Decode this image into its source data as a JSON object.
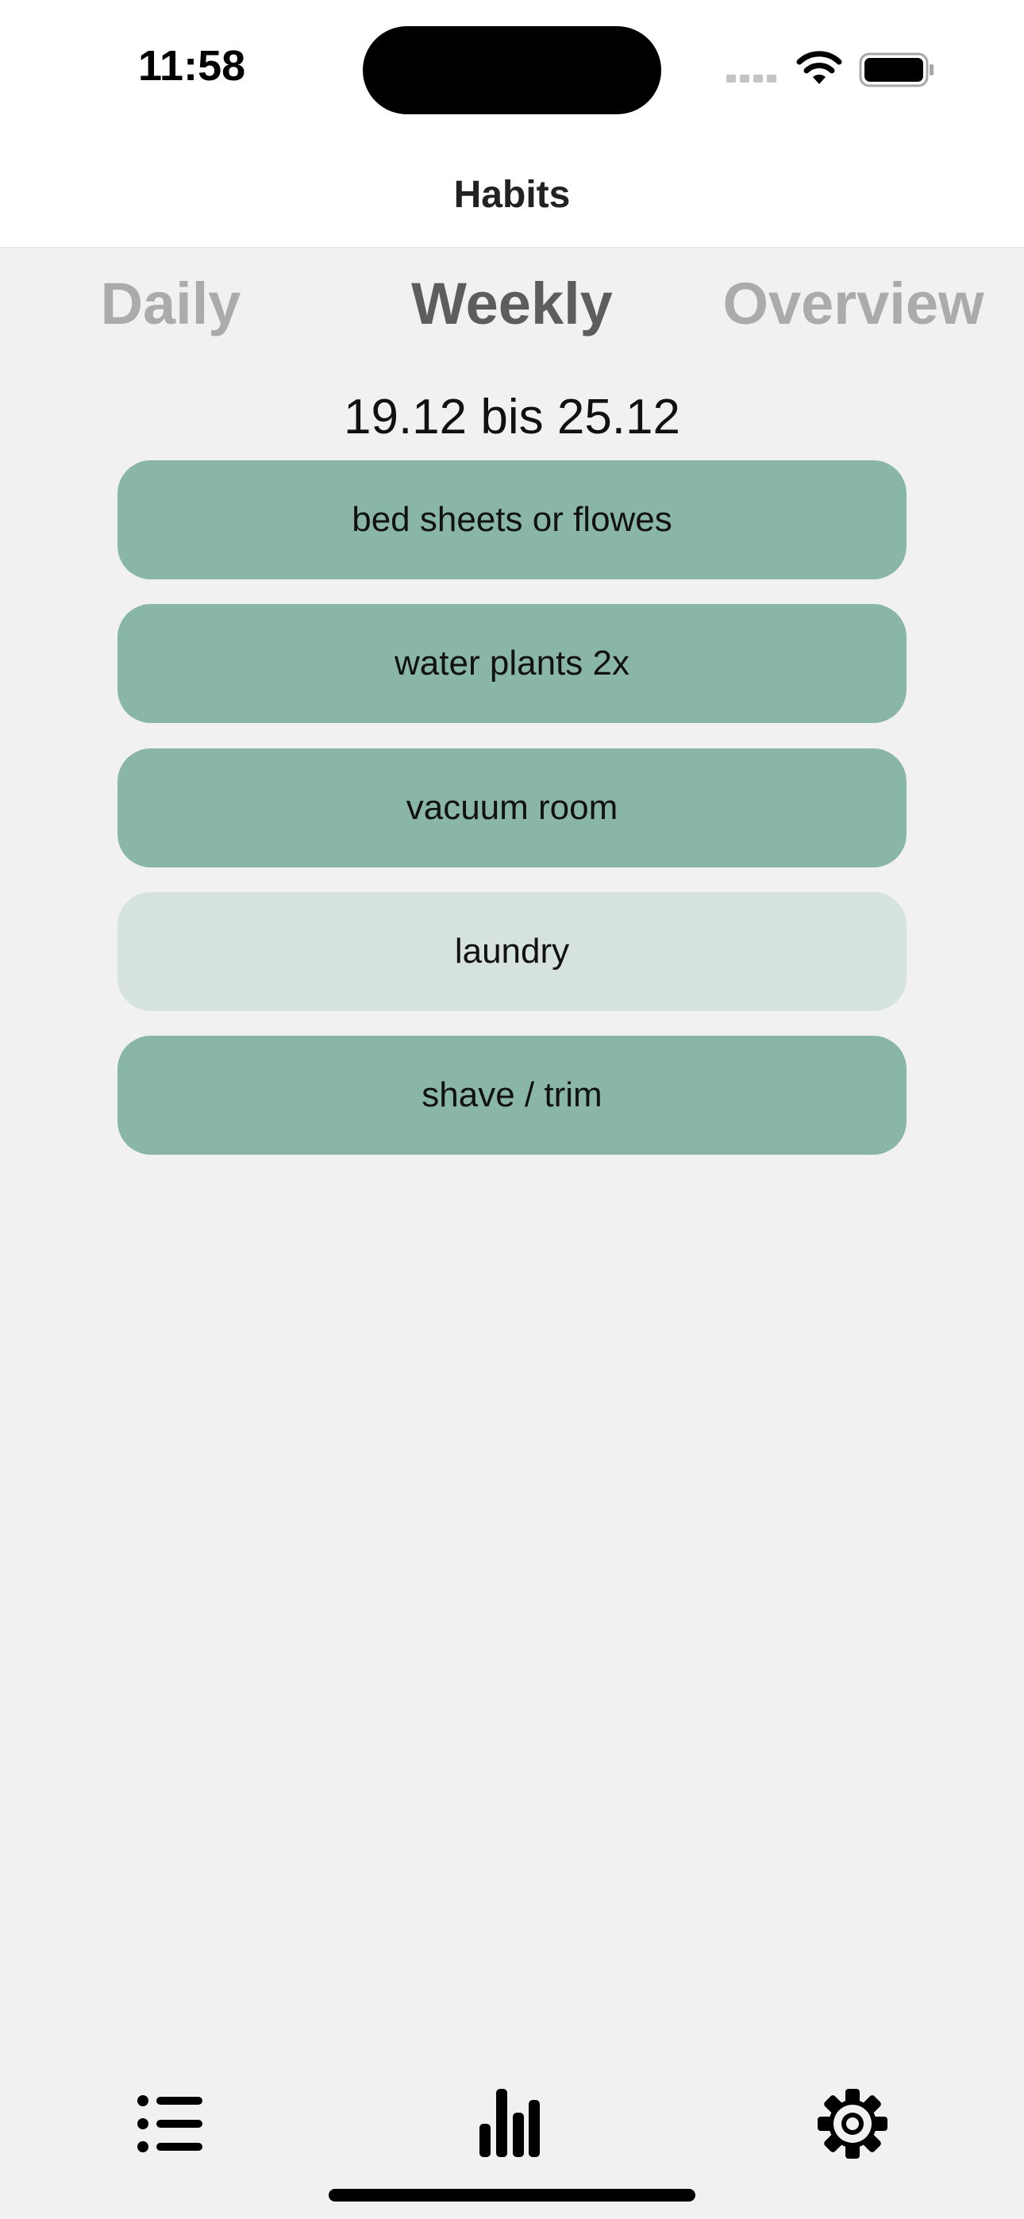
{
  "status_bar": {
    "time": "11:58"
  },
  "nav": {
    "title": "Habits"
  },
  "segments": [
    {
      "label": "Daily",
      "selected": false
    },
    {
      "label": "Weekly",
      "selected": true
    },
    {
      "label": "Overview",
      "selected": false
    }
  ],
  "date_range": "19.12 bis 25.12",
  "habits": [
    {
      "label": "bed sheets or flowes",
      "done": true
    },
    {
      "label": "water plants 2x",
      "done": true
    },
    {
      "label": "vacuum room",
      "done": true
    },
    {
      "label": "laundry",
      "done": false
    },
    {
      "label": "shave / trim",
      "done": true
    }
  ],
  "tab_bar": {
    "items": [
      {
        "icon": "list-icon"
      },
      {
        "icon": "bar-chart-icon",
        "selected": true
      },
      {
        "icon": "gear-icon"
      }
    ]
  },
  "colors": {
    "done": "#8ab6a8",
    "pending": "#d6e2df",
    "background": "#f1f1f1",
    "segment_active": "#5d5d5d",
    "segment_inactive": "#ababab"
  }
}
